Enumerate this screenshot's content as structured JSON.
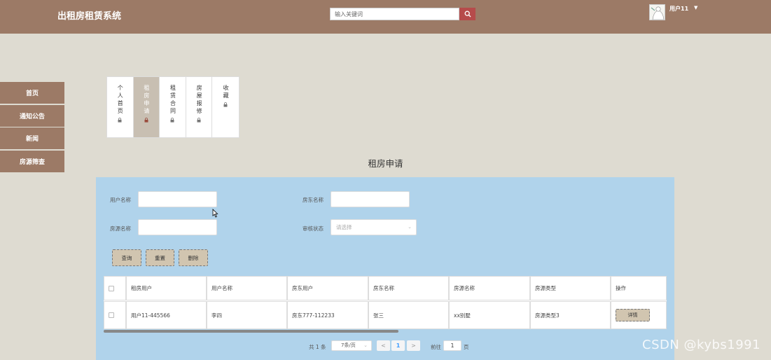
{
  "header": {
    "title": "出租房租赁系统",
    "search_placeholder": "输入关键词",
    "user_name": "用户11",
    "caret": "▼"
  },
  "side_nav": {
    "items": [
      {
        "label": "首页"
      },
      {
        "label": "通知公告"
      },
      {
        "label": "新闻"
      },
      {
        "label": "房源筛查"
      }
    ]
  },
  "tabs": [
    {
      "label": "个人首页",
      "active": false
    },
    {
      "label": "租房申请",
      "active": true
    },
    {
      "label": "租赁合同",
      "active": false
    },
    {
      "label": "房屋报修",
      "active": false
    },
    {
      "label": "收藏",
      "active": false
    }
  ],
  "page_title": "租房申请",
  "search_form": {
    "user_name_label": "用户名称",
    "landlord_name_label": "房东名称",
    "house_name_label": "房源名称",
    "review_status_label": "审核状态",
    "review_status_placeholder": "请选择",
    "query_label": "查询",
    "reset_label": "重置",
    "delete_label": "删除"
  },
  "table": {
    "columns": [
      "租房用户",
      "用户名称",
      "房东用户",
      "房东名称",
      "房源名称",
      "房源类型",
      "操作"
    ],
    "rows": [
      {
        "rent_user": "用户11-445566",
        "user_name": "李四",
        "landlord_user": "房东777-112233",
        "landlord_name": "张三",
        "house_name": "xx别墅",
        "house_type": "房源类型3",
        "action": "详情"
      }
    ]
  },
  "pagination": {
    "total_text": "共 1 条",
    "page_size": "7条/页",
    "prev": "<",
    "current_page": "1",
    "next": ">",
    "goto_label": "前往",
    "goto_value": "1",
    "page_suffix": "页"
  },
  "watermark": "CSDN @kybs1991",
  "colors": {
    "header_bg": "#9c7a66",
    "page_bg": "#dedbd1",
    "panel_bg": "#b0d3eb",
    "button_bg": "#d1c5b0",
    "search_button": "#b64b4b"
  }
}
